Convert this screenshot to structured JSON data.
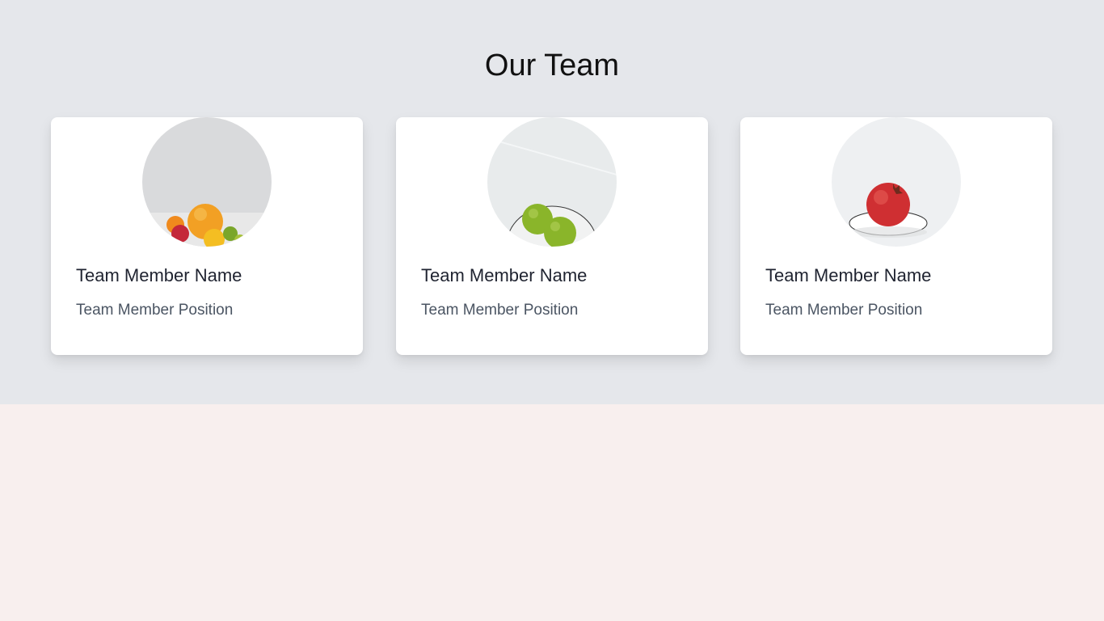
{
  "section": {
    "title": "Our Team"
  },
  "colors": {
    "section_background": "#e5e7eb",
    "page_background": "#f8efee",
    "card_background": "#ffffff"
  },
  "members": [
    {
      "name": "Team Member Name",
      "position": "Team Member Position",
      "photo": "assorted-citrus-fruits-photo"
    },
    {
      "name": "Team Member Name",
      "position": "Team Member Position",
      "photo": "limes-on-plate-photo"
    },
    {
      "name": "Team Member Name",
      "position": "Team Member Position",
      "photo": "pomegranate-on-plate-photo"
    }
  ]
}
